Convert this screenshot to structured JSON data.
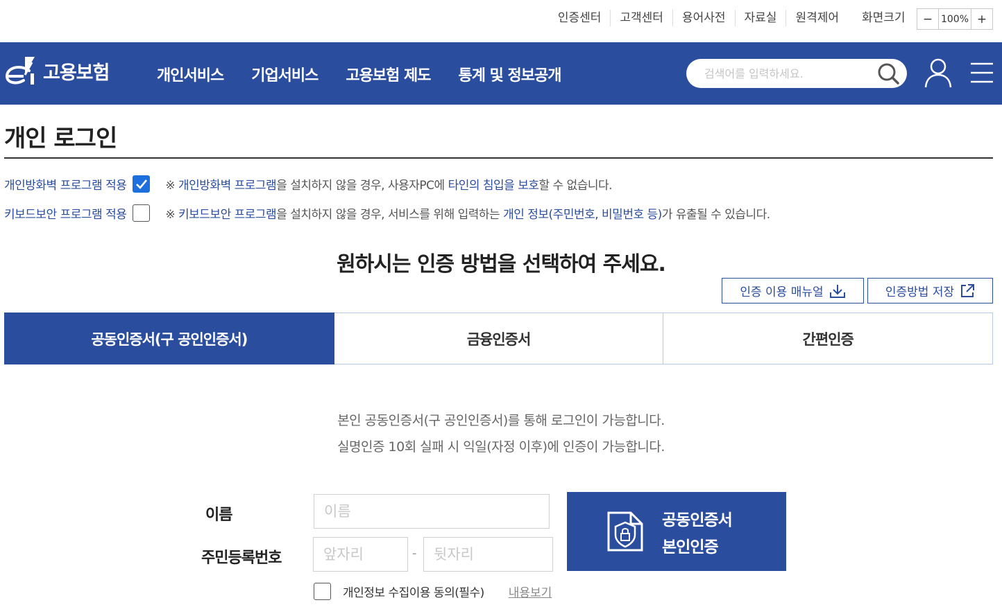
{
  "util": {
    "links": [
      "인증센터",
      "고객센터",
      "용어사전",
      "자료실",
      "원격제어"
    ],
    "zoom_label": "화면크기",
    "zoom_minus": "−",
    "zoom_value": "100%",
    "zoom_plus": "+"
  },
  "header": {
    "logo_text": "고용보험",
    "nav": [
      "개인서비스",
      "기업서비스",
      "고용보험 제도",
      "통계 및 정보공개"
    ],
    "search_placeholder": "검색어를 입력하세요.",
    "brand_color": "#2a4d9e"
  },
  "page": {
    "title": "개인 로그인"
  },
  "options": {
    "firewall": {
      "label": "개인방화벽 프로그램 적용",
      "checked": true,
      "note_prefix": "※ ",
      "note_hl1": "개인방화벽 프로그램",
      "note_mid1": "을 설치하지 않을 경우, 사용자PC에 ",
      "note_hl2": "타인의 침입을 보호",
      "note_end": "할 수 없습니다."
    },
    "keyboard": {
      "label": "키보드보안 프로그램 적용",
      "checked": false,
      "note_prefix": "※ ",
      "note_hl1": "키보드보안 프로그램",
      "note_mid1": "을 설치하지 않을 경우, 서비스를 위해 입력하는 ",
      "note_hl2": "개인 정보(주민번호, 비밀번호 등)",
      "note_end": "가 유출될 수 있습니다."
    }
  },
  "auth": {
    "heading": "원하시는 인증 방법을 선택하여 주세요.",
    "manual_btn": "인증 이용 매뉴얼",
    "save_btn": "인증방법 저장",
    "tabs": [
      "공동인증서(구 공인인증서)",
      "금융인증서",
      "간편인증"
    ],
    "active_tab": 0,
    "info_line1": "본인 공동인증서(구 공인인증서)를 통해 로그인이 가능합니다.",
    "info_line2": "실명인증 10회 실패 시 익일(자정 이후)에 인증이 가능합니다."
  },
  "form": {
    "name_label": "이름",
    "name_placeholder": "이름",
    "rrn_label": "주민등록번호",
    "rrn_front_placeholder": "앞자리",
    "rrn_sep": "-",
    "rrn_back_placeholder": "뒷자리",
    "cert_btn_line1": "공동인증서",
    "cert_btn_line2": "본인인증",
    "agree_label": "개인정보 수집이용 동의(필수)",
    "agree_checked": false,
    "agree_link": "내용보기"
  }
}
